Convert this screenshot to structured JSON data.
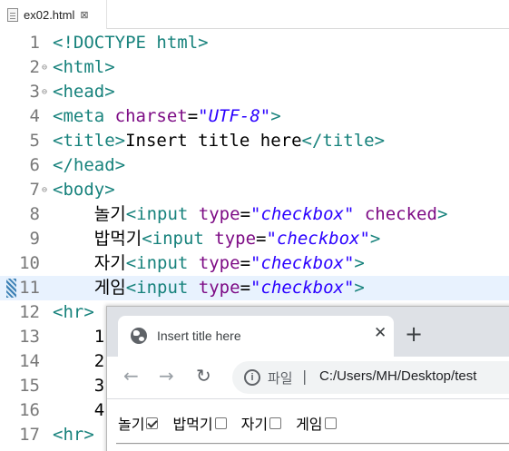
{
  "editor_tab": {
    "filename": "ex02.html",
    "close_glyph": "⊠"
  },
  "code_lines": [
    {
      "num": "1",
      "parts": [
        {
          "t": "<!DOCTYPE html>",
          "c": "tg"
        }
      ]
    },
    {
      "num": "2",
      "fold": true,
      "parts": [
        {
          "t": "<html>",
          "c": "tg"
        }
      ]
    },
    {
      "num": "3",
      "fold": true,
      "parts": [
        {
          "t": "<head>",
          "c": "tg"
        }
      ]
    },
    {
      "num": "4",
      "parts": [
        {
          "t": "<meta ",
          "c": "tg"
        },
        {
          "t": "charset",
          "c": "at"
        },
        {
          "t": "=",
          "c": "tx"
        },
        {
          "t": "\"UTF-8\"",
          "c": "vl"
        },
        {
          "t": ">",
          "c": "tg"
        }
      ]
    },
    {
      "num": "5",
      "parts": [
        {
          "t": "<title>",
          "c": "tg"
        },
        {
          "t": "Insert title here",
          "c": "tx"
        },
        {
          "t": "</title>",
          "c": "tg"
        }
      ]
    },
    {
      "num": "6",
      "parts": [
        {
          "t": "</head>",
          "c": "tg"
        }
      ]
    },
    {
      "num": "7",
      "fold": true,
      "parts": [
        {
          "t": "<body>",
          "c": "tg"
        }
      ]
    },
    {
      "num": "8",
      "parts": [
        {
          "t": "    놀기",
          "c": "tx"
        },
        {
          "t": "<input ",
          "c": "tg"
        },
        {
          "t": "type",
          "c": "at"
        },
        {
          "t": "=",
          "c": "tx"
        },
        {
          "t": "\"checkbox\"",
          "c": "vl"
        },
        {
          "t": " ",
          "c": "tx"
        },
        {
          "t": "checked",
          "c": "at"
        },
        {
          "t": ">",
          "c": "tg"
        }
      ]
    },
    {
      "num": "9",
      "parts": [
        {
          "t": "    밥먹기",
          "c": "tx"
        },
        {
          "t": "<input ",
          "c": "tg"
        },
        {
          "t": "type",
          "c": "at"
        },
        {
          "t": "=",
          "c": "tx"
        },
        {
          "t": "\"checkbox\"",
          "c": "vl"
        },
        {
          "t": ">",
          "c": "tg"
        }
      ]
    },
    {
      "num": "10",
      "parts": [
        {
          "t": "    자기",
          "c": "tx"
        },
        {
          "t": "<input ",
          "c": "tg"
        },
        {
          "t": "type",
          "c": "at"
        },
        {
          "t": "=",
          "c": "tx"
        },
        {
          "t": "\"checkbox\"",
          "c": "vl"
        },
        {
          "t": ">",
          "c": "tg"
        }
      ]
    },
    {
      "num": "11",
      "current": true,
      "marker": true,
      "parts": [
        {
          "t": "    게임",
          "c": "tx"
        },
        {
          "t": "<input ",
          "c": "tg"
        },
        {
          "t": "type",
          "c": "at"
        },
        {
          "t": "=",
          "c": "tx"
        },
        {
          "t": "\"checkbox\"",
          "c": "vl"
        },
        {
          "t": ">",
          "c": "tg"
        }
      ]
    },
    {
      "num": "12",
      "parts": [
        {
          "t": "<hr>",
          "c": "tg"
        }
      ]
    },
    {
      "num": "13",
      "parts": [
        {
          "t": "    1",
          "c": "tx"
        }
      ]
    },
    {
      "num": "14",
      "parts": [
        {
          "t": "    2",
          "c": "tx"
        }
      ]
    },
    {
      "num": "15",
      "parts": [
        {
          "t": "    3",
          "c": "tx"
        }
      ]
    },
    {
      "num": "16",
      "parts": [
        {
          "t": "    4",
          "c": "tx"
        }
      ]
    },
    {
      "num": "17",
      "parts": [
        {
          "t": "<hr>",
          "c": "tg"
        }
      ]
    }
  ],
  "browser": {
    "tab_title": "Insert title here",
    "tab_close": "✕",
    "new_tab": "+",
    "back": "←",
    "forward": "→",
    "reload": "↻",
    "info_glyph": "i",
    "scheme_label": "파일",
    "separator": "|",
    "url": "C:/Users/MH/Desktop/test",
    "checkboxes": [
      {
        "label": "놀기",
        "checked": true
      },
      {
        "label": "밥먹기",
        "checked": false
      },
      {
        "label": "자기",
        "checked": false
      },
      {
        "label": "게임",
        "checked": false
      }
    ]
  }
}
